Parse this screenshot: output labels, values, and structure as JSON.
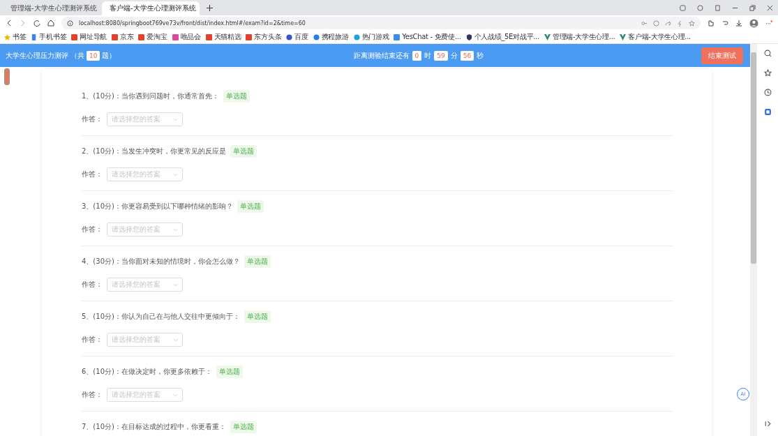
{
  "browser": {
    "tabs": [
      {
        "label": "管理端-大学生心理测评系统",
        "selected": false
      },
      {
        "label": "客户端-大学生心理测评系统",
        "selected": true
      }
    ],
    "url": "localhost:8080/springboot769ve73v/front/dist/index.html#/exam?id=2&time=60",
    "bookmarks": [
      {
        "label": "书签",
        "kind": "star"
      },
      {
        "label": "手机书签",
        "kind": "phone"
      },
      {
        "label": "网址导航",
        "kind": "red"
      },
      {
        "label": "京东",
        "kind": "red"
      },
      {
        "label": "爱淘宝",
        "kind": "red"
      },
      {
        "label": "唯品会",
        "kind": "pink"
      },
      {
        "label": "天猫精选",
        "kind": "red"
      },
      {
        "label": "东方头条",
        "kind": "red"
      },
      {
        "label": "百度",
        "kind": "paw"
      },
      {
        "label": "携程旅游",
        "kind": "swirl"
      },
      {
        "label": "热门游戏",
        "kind": "ring"
      },
      {
        "label": "YesChat - 免费使...",
        "kind": "ai"
      },
      {
        "label": "个人战绩_5E对战平...",
        "kind": "shield"
      },
      {
        "label": "管理端-大学生心理...",
        "kind": "vue"
      },
      {
        "label": "客户端-大学生心理...",
        "kind": "vue"
      }
    ]
  },
  "header": {
    "title": "大学生心理压力测评",
    "total_before": "（共",
    "total": "10",
    "total_after": "题）",
    "countdown_label": "距离测验结束还有",
    "hours": "0",
    "hours_unit": "时",
    "minutes": "59",
    "minutes_unit": "分",
    "seconds": "56",
    "seconds_unit": "秒",
    "end_button": "结束测试"
  },
  "questions": [
    {
      "title": "1、(10分)：当你遇到问题时，你通常首先：",
      "tag": "单选题",
      "answer_label": "作答：",
      "placeholder": "请选择您的答案"
    },
    {
      "title": "2、(10分)：当发生冲突时，你更常见的反应是",
      "tag": "单选题",
      "answer_label": "作答：",
      "placeholder": "请选择您的答案"
    },
    {
      "title": "3、(10分)：你更容易受到以下哪种情绪的影响？",
      "tag": "单选题",
      "answer_label": "作答：",
      "placeholder": "请选择您的答案"
    },
    {
      "title": "4、(30分)：当你面对未知的情境时，你会怎么做？",
      "tag": "单选题",
      "answer_label": "作答：",
      "placeholder": "请选择您的答案"
    },
    {
      "title": "5、(10分)：你认为自己在与他人交往中更倾向于：",
      "tag": "单选题",
      "answer_label": "作答：",
      "placeholder": "请选择您的答案"
    },
    {
      "title": "6、(10分)：在做决定时，你更多依赖于：",
      "tag": "单选题",
      "answer_label": "作答：",
      "placeholder": "请选择您的答案"
    },
    {
      "title": "7、(10分)：在目标达成的过程中，你更看重：",
      "tag": "单选题"
    }
  ],
  "assistant_button": "AI"
}
